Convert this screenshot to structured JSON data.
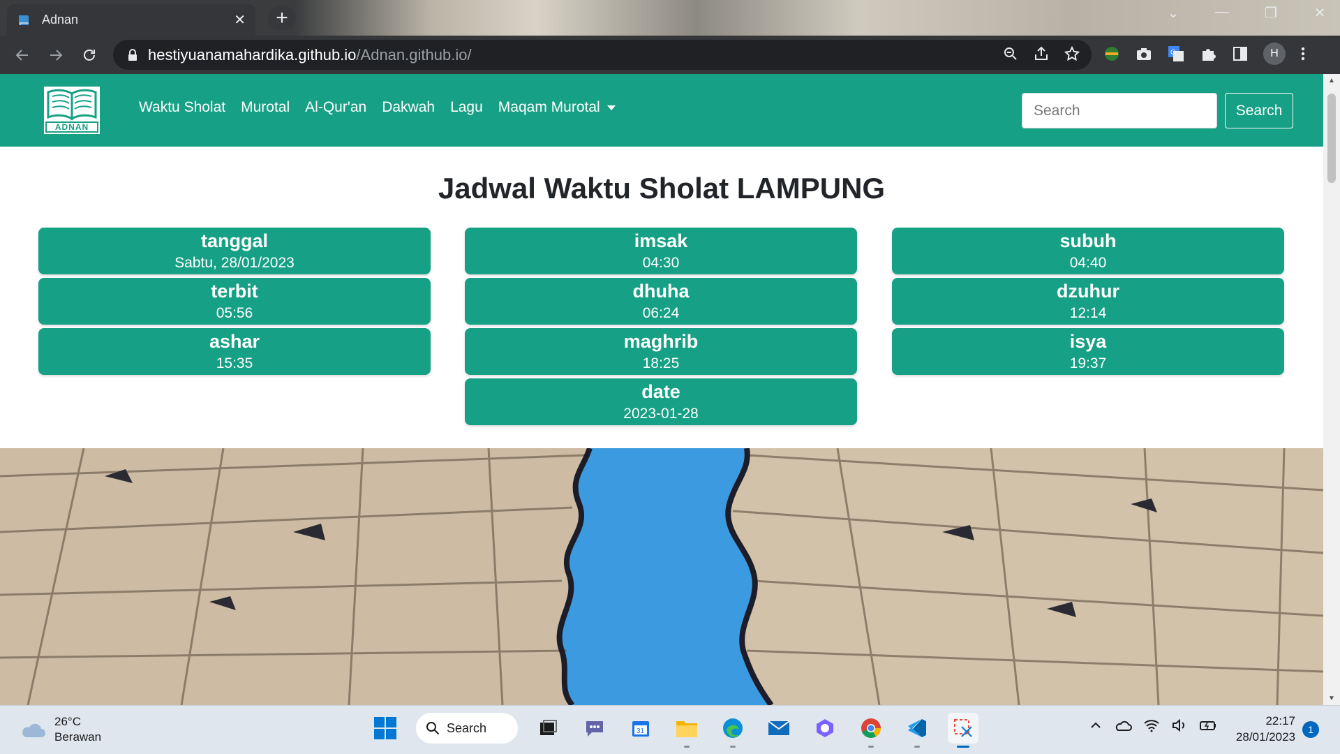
{
  "browser": {
    "tab_title": "Adnan",
    "url_host": "hestiyuanamahardika.github.io",
    "url_path": "/Adnan.github.io/",
    "profile_initial": "H"
  },
  "site": {
    "logo_text": "ADNAN",
    "nav": [
      {
        "label": "Waktu Sholat"
      },
      {
        "label": "Murotal"
      },
      {
        "label": "Al-Qur'an"
      },
      {
        "label": "Dakwah"
      },
      {
        "label": "Lagu"
      },
      {
        "label": "Maqam Murotal"
      }
    ],
    "search_placeholder": "Search",
    "search_button": "Search",
    "page_title": "Jadwal Waktu Sholat LAMPUNG",
    "prayer_cards": [
      {
        "label": "tanggal",
        "value": "Sabtu, 28/01/2023"
      },
      {
        "label": "imsak",
        "value": "04:30"
      },
      {
        "label": "subuh",
        "value": "04:40"
      },
      {
        "label": "terbit",
        "value": "05:56"
      },
      {
        "label": "dhuha",
        "value": "06:24"
      },
      {
        "label": "dzuhur",
        "value": "12:14"
      },
      {
        "label": "ashar",
        "value": "15:35"
      },
      {
        "label": "maghrib",
        "value": "18:25"
      },
      {
        "label": "isya",
        "value": "19:37"
      },
      {
        "label": "date",
        "value": "2023-01-28"
      }
    ],
    "theme_color": "#16a085"
  },
  "taskbar": {
    "weather_temp": "26°C",
    "weather_desc": "Berawan",
    "search_label": "Search",
    "time": "22:17",
    "date": "28/01/2023",
    "notification_count": "1",
    "apps": [
      "task-view",
      "teams-chat",
      "calendar",
      "file-explorer",
      "edge",
      "mail",
      "copilot",
      "chrome",
      "vscode",
      "snipping-tool"
    ]
  }
}
